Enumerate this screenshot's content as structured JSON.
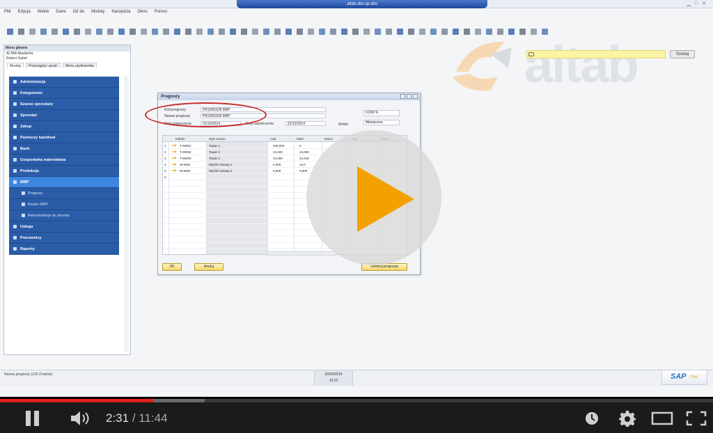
{
  "sap": {
    "window_title": "altab.sbo.sp.sbo",
    "menu": [
      "Plik",
      "Edycja",
      "Widok",
      "Dane",
      "Idź do",
      "Moduły",
      "Narzędzia",
      "Okno",
      "Pomoc"
    ],
    "search_button": "Szukaj",
    "logo_text": "altab",
    "main_menu": {
      "title": "Menu główne",
      "company": "ALTAB Akademia",
      "user": "Robert Gabel",
      "tabs": [
        "Moduły",
        "Przeciągnij i upuść",
        "Menu użytkownika"
      ],
      "items": [
        {
          "label": "Administracja"
        },
        {
          "label": "Księgowość"
        },
        {
          "label": "Szanse sprzedaży"
        },
        {
          "label": "Sprzedaż"
        },
        {
          "label": "Zakup"
        },
        {
          "label": "Partnerzy handlowi"
        },
        {
          "label": "Bank"
        },
        {
          "label": "Gospodarka materiałowa"
        },
        {
          "label": "Produkcja"
        },
        {
          "label": "MRP"
        }
      ],
      "subitems": [
        {
          "label": "Prognozy"
        },
        {
          "label": "Kreator MRP"
        },
        {
          "label": "Rekomendacje do zlecenia"
        }
      ],
      "items_after": [
        {
          "label": "Usługa"
        },
        {
          "label": "Pracownicy"
        },
        {
          "label": "Raporty"
        }
      ]
    },
    "dialog": {
      "title": "Prognozy",
      "kod_label": "Kod prognozy",
      "kod_value": "PR10091D8 MRP",
      "nazwa_label": "Nazwa prognozy",
      "nazwa_value": "PR10091D8 MRP",
      "start_label": "Data rozpoczęcia",
      "start_value": "01/10/2014",
      "end_label": "Data zakończenia",
      "end_value": "31/12/2014",
      "view_label": "Widok",
      "view_value": "Miesięczne",
      "pct_value": "0,000 %",
      "columns": [
        "Indeks",
        "Opis towaru",
        "Luty",
        "Marz.",
        "Kwiec.",
        "Maj",
        "Czerw."
      ],
      "rows": [
        {
          "n": "1",
          "code": "T-00001",
          "desc": "Towar 1",
          "v1": "200,000",
          "v2": "0"
        },
        {
          "n": "2",
          "code": "T-00002",
          "desc": "Towar 2",
          "v1": "24,000",
          "v2": "24,000"
        },
        {
          "n": "3",
          "code": "T-00003",
          "desc": "Towar 3",
          "v1": "24,000",
          "v2": "24,240"
        },
        {
          "n": "4",
          "code": "W-0001",
          "desc": "Wyrób Gotowy 1",
          "v1": "0,000",
          "v2": "12,0"
        },
        {
          "n": "5",
          "code": "W-0002",
          "desc": "Wyrób Gotowy 2",
          "v1": "0,000",
          "v2": "0,000"
        },
        {
          "n": "6",
          "code": "",
          "desc": "",
          "v1": "",
          "v2": ""
        }
      ],
      "ok_button": "OK",
      "cancel_button": "Anuluj",
      "generate_button": "Generuj prognozę"
    },
    "status_message": "Nazwa prognozy (100 Znaków)",
    "status_date": "30/09/2014",
    "status_time": "10:22",
    "sap_logo": "SAP",
    "sap_logo_suffix": "One"
  },
  "player": {
    "current_time": "2:31",
    "separator": "/",
    "duration": "11:44",
    "progress_played": 0.2145,
    "progress_buffered": 0.287,
    "colors": {
      "accent": "#e0201b",
      "play": "#f4a100"
    }
  }
}
